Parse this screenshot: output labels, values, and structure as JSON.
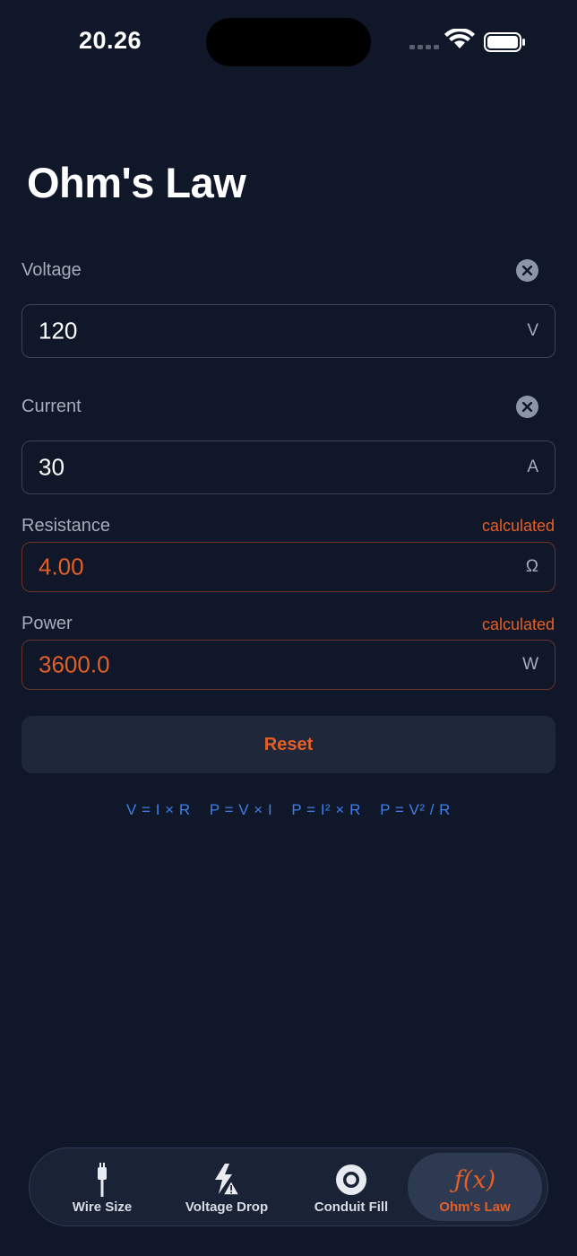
{
  "status_bar": {
    "time": "20.26"
  },
  "page": {
    "title": "Ohm's Law"
  },
  "fields": {
    "voltage": {
      "label": "Voltage",
      "value": "120",
      "unit": "V"
    },
    "current": {
      "label": "Current",
      "value": "30",
      "unit": "A"
    },
    "resistance": {
      "label": "Resistance",
      "value": "4.00",
      "unit": "Ω",
      "tag": "calculated"
    },
    "power": {
      "label": "Power",
      "value": "3600.0",
      "unit": "W",
      "tag": "calculated"
    }
  },
  "reset_label": "Reset",
  "formulas": [
    "V = I × R",
    "P = V × I",
    "P = I² × R",
    "P = V² / R"
  ],
  "tabs": [
    {
      "label": "Wire Size",
      "icon": "wire-plug-icon"
    },
    {
      "label": "Voltage Drop",
      "icon": "bolt-warning-icon"
    },
    {
      "label": "Conduit Fill",
      "icon": "conduit-circle-icon"
    },
    {
      "label": "Ohm's Law",
      "icon": "function-icon",
      "icon_text": "ƒ(x)",
      "active": true
    }
  ],
  "colors": {
    "background": "#0f1729",
    "accent": "#e45f27",
    "formula": "#3f7ee6"
  }
}
